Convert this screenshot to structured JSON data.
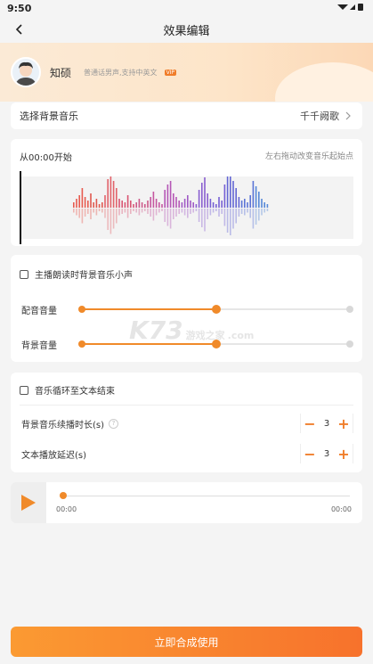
{
  "status": {
    "time": "9:50"
  },
  "header": {
    "title": "效果编辑"
  },
  "profile": {
    "name": "知硕",
    "desc": "普通话男声,支持中英文",
    "badge": "VIP"
  },
  "music": {
    "label": "选择背景音乐",
    "value": "千千阙歌"
  },
  "wave": {
    "start_label": "从00:00开始",
    "hint": "左右拖动改变音乐起始点"
  },
  "volume": {
    "checkbox_label": "主播朗读时背景音乐小声",
    "dub_label": "配音音量",
    "dub_level": 0.5,
    "bg_label": "背景音量",
    "bg_level": 0.5
  },
  "loop": {
    "checkbox_label": "音乐循环至文本结束",
    "duration_label": "背景音乐续播时长(s)",
    "duration_value": "3",
    "delay_label": "文本播放延迟(s)",
    "delay_value": "3",
    "minus": "−",
    "plus": "+"
  },
  "player": {
    "current_time": "00:00",
    "total_time": "00:00",
    "progress": 0
  },
  "action": {
    "submit_label": "立即合成使用"
  },
  "watermark": {
    "main": "K73",
    "sub": "游戏之家",
    "domain": ".com"
  },
  "colors": {
    "accent": "#f08a2a"
  }
}
